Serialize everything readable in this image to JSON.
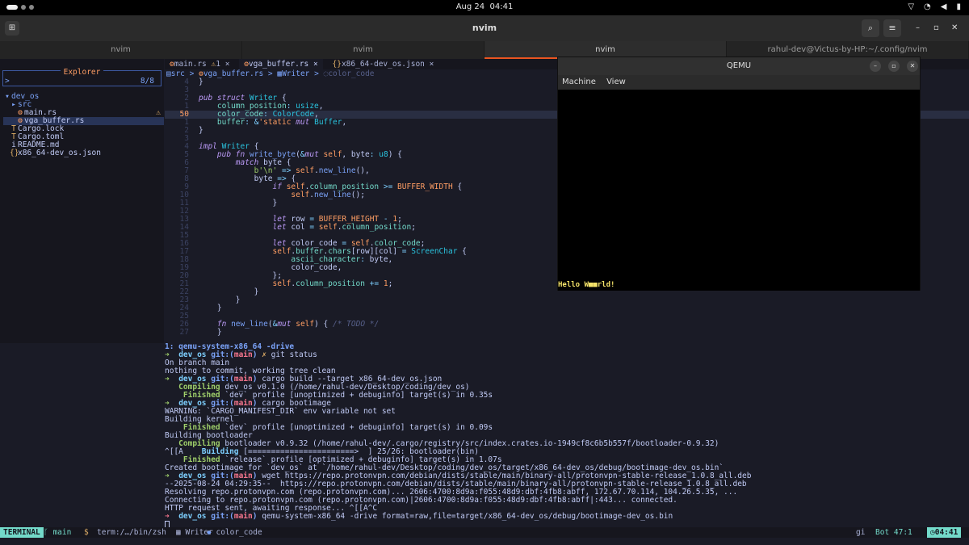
{
  "topbar": {
    "date": "Aug 24",
    "time": "04:41"
  },
  "window": {
    "title": "nvim"
  },
  "tabs": [
    {
      "label": "nvim",
      "active": false
    },
    {
      "label": "nvim",
      "active": false
    },
    {
      "label": "nvim",
      "active": true
    },
    {
      "label": "rahul-dev@Victus-by-HP:~/.config/nvim",
      "active": false
    }
  ],
  "explorer": {
    "title": "Explorer",
    "prompt": ">",
    "count": "8/8",
    "tree": [
      {
        "icon": "▾",
        "label": "dev_os",
        "color": "#7aa2f7",
        "indent": 0
      },
      {
        "icon": "▸",
        "label": "src",
        "color": "#7aa2f7",
        "indent": 1
      },
      {
        "icon": "⚙",
        "label": "main.rs",
        "color": "#c0caf5",
        "indent": 2,
        "warn": "⚠"
      },
      {
        "icon": "⚙",
        "label": "vga_buffer.rs",
        "color": "#c0caf5",
        "indent": 2,
        "selected": true
      },
      {
        "icon": "T",
        "label": "Cargo.lock",
        "color": "#c0caf5",
        "indent": 1
      },
      {
        "icon": "T",
        "label": "Cargo.toml",
        "color": "#c0caf5",
        "indent": 1
      },
      {
        "icon": "i",
        "label": "README.md",
        "color": "#c0caf5",
        "indent": 1
      },
      {
        "icon": "{}",
        "label": "x86_64-dev_os.json",
        "color": "#c0caf5",
        "indent": 1
      }
    ]
  },
  "buffers": [
    {
      "label": "main.rs",
      "extra": "1",
      "active": false
    },
    {
      "label": "vga_buffer.rs",
      "extra": "",
      "active": true
    },
    {
      "label": "x86_64-dev_os.json",
      "extra": "",
      "active": false
    }
  ],
  "breadcrumbs": {
    "a": "src",
    "b": "vga_buffer.rs",
    "c": "Writer",
    "d": "color_code"
  },
  "code_lines": [
    {
      "num": "4",
      "html": "<span class='v'>}</span>"
    },
    {
      "num": "3",
      "html": ""
    },
    {
      "num": "2",
      "html": "<span class='k'>pub struct</span> <span class='t'>Writer</span> <span class='v'>{</span>"
    },
    {
      "num": "1",
      "html": "    <span class='fld'>column_position</span><span class='p'>:</span> <span class='t'>usize</span><span class='v'>,</span>"
    },
    {
      "num": "50",
      "cur": true,
      "html": "    <span class='fld'>color_code</span><span class='p'>:</span> <span class='t'>ColorCode</span><span class='v'>,</span>"
    },
    {
      "num": "1",
      "html": "    <span class='fld'>buffer</span><span class='p'>:</span> <span class='p'>&amp;</span><span class='n'>'static</span> <span class='k'>mut</span> <span class='t'>Buffer</span><span class='v'>,</span>"
    },
    {
      "num": "2",
      "html": "<span class='v'>}</span>"
    },
    {
      "num": "3",
      "html": ""
    },
    {
      "num": "4",
      "html": "<span class='k'>impl</span> <span class='t'>Writer</span> <span class='v'>{</span>"
    },
    {
      "num": "5",
      "html": "    <span class='k'>pub fn</span> <span class='f'>write_byte</span><span class='v'>(</span><span class='p'>&amp;</span><span class='k'>mut</span> <span class='n'>self</span><span class='v'>,</span> <span class='v'>byte</span><span class='p'>:</span> <span class='t'>u8</span><span class='v'>) {</span>"
    },
    {
      "num": "6",
      "html": "        <span class='k'>match</span> <span class='v'>byte {</span>"
    },
    {
      "num": "7",
      "html": "            <span class='s'>b'\\n'</span> <span class='p'>=&gt;</span> <span class='n'>self</span><span class='v'>.</span><span class='f'>new_line</span><span class='v'>(),</span>"
    },
    {
      "num": "8",
      "html": "            <span class='v'>byte</span> <span class='p'>=&gt;</span> <span class='v'>{</span>"
    },
    {
      "num": "9",
      "html": "                <span class='k'>if</span> <span class='n'>self</span><span class='v'>.</span><span class='fld'>column_position</span> <span class='p'>&gt;=</span> <span class='cst'>BUFFER_WIDTH</span> <span class='v'>{</span>"
    },
    {
      "num": "10",
      "html": "                    <span class='n'>self</span><span class='v'>.</span><span class='f'>new_line</span><span class='v'>();</span>"
    },
    {
      "num": "11",
      "html": "                <span class='v'>}</span>"
    },
    {
      "num": "12",
      "html": ""
    },
    {
      "num": "13",
      "html": "                <span class='k'>let</span> <span class='v'>row</span> <span class='p'>=</span> <span class='cst'>BUFFER_HEIGHT</span> <span class='p'>-</span> <span class='n'>1</span><span class='v'>;</span>"
    },
    {
      "num": "14",
      "html": "                <span class='k'>let</span> <span class='v'>col</span> <span class='p'>=</span> <span class='n'>self</span><span class='v'>.</span><span class='fld'>column_position</span><span class='v'>;</span>"
    },
    {
      "num": "15",
      "html": ""
    },
    {
      "num": "16",
      "html": "                <span class='k'>let</span> <span class='v'>color_code</span> <span class='p'>=</span> <span class='n'>self</span><span class='v'>.</span><span class='fld'>color_code</span><span class='v'>;</span>"
    },
    {
      "num": "17",
      "html": "                <span class='n'>self</span><span class='v'>.</span><span class='fld'>buffer</span><span class='v'>.</span><span class='fld'>chars</span><span class='v'>[row][col]</span> <span class='p'>=</span> <span class='t'>ScreenChar</span> <span class='v'>{</span>"
    },
    {
      "num": "18",
      "html": "                    <span class='fld'>ascii_character</span><span class='p'>:</span> <span class='v'>byte,</span>"
    },
    {
      "num": "19",
      "html": "                    <span class='v'>color_code,</span>"
    },
    {
      "num": "20",
      "html": "                <span class='v'>};</span>"
    },
    {
      "num": "21",
      "html": "                <span class='n'>self</span><span class='v'>.</span><span class='fld'>column_position</span> <span class='p'>+=</span> <span class='n'>1</span><span class='v'>;</span>"
    },
    {
      "num": "22",
      "html": "            <span class='v'>}</span>"
    },
    {
      "num": "23",
      "html": "        <span class='v'>}</span>"
    },
    {
      "num": "24",
      "html": "    <span class='v'>}</span>"
    },
    {
      "num": "25",
      "html": ""
    },
    {
      "num": "26",
      "html": "    <span class='k'>fn</span> <span class='f'>new_line</span><span class='v'>(</span><span class='p'>&amp;</span><span class='k'>mut</span> <span class='n'>self</span><span class='v'>) {</span> <span class='c'>/* TODO */</span>"
    },
    {
      "num": "27",
      "html": "    <span class='v'>}</span>"
    }
  ],
  "qemu": {
    "title": "QEMU",
    "menu": [
      "Machine",
      "View"
    ],
    "screen_text": "Hello W■■rld!"
  },
  "terminal_lines": [
    "<span class='bl'>1: qemu-system-x86_64 -drive</span>",
    "<span class='g'>➜</span>  <span class='cy'>dev_os</span> <span class='bl'>git:(</span><span class='rd'>main</span><span class='bl'>)</span> <span class='yl'>✗</span> git status",
    "On branch main",
    "nothing to commit, working tree clean",
    "<span class='g'>➜</span>  <span class='cy'>dev_os</span> <span class='bl'>git:(</span><span class='rd'>main</span><span class='bl'>)</span> cargo build --target x86_64-dev_os.json",
    "   <span class='g'>Compiling</span> dev_os v0.1.0 (/home/rahul-dev/Desktop/coding/dev_os)",
    "    <span class='g'>Finished</span> `dev` profile [unoptimized + debuginfo] target(s) in 0.35s",
    "<span class='g'>➜</span>  <span class='cy'>dev_os</span> <span class='bl'>git:(</span><span class='rd'>main</span><span class='bl'>)</span> cargo bootimage",
    "WARNING: `CARGO_MANIFEST_DIR` env variable not set",
    "Building kernel",
    "    <span class='g'>Finished</span> `dev` profile [unoptimized + debuginfo] target(s) in 0.09s",
    "Building bootloader",
    "   <span class='g'>Compiling</span> bootloader v0.9.32 (/home/rahul-dev/.cargo/registry/src/index.crates.io-1949cf8c6b5b557f/bootloader-0.9.32)",
    "^[[A    <span class='cy'>Building</span> [=======================&gt;  ] 25/26: bootloader(bin)",
    "    <span class='g'>Finished</span> `release` profile [optimized + debuginfo] target(s) in 1.07s",
    "Created bootimage for `dev_os` at `/home/rahul-dev/Desktop/coding/dev_os/target/x86_64-dev_os/debug/bootimage-dev_os.bin`",
    "<span class='g'>➜</span>  <span class='cy'>dev_os</span> <span class='bl'>git:(</span><span class='rd'>main</span><span class='bl'>)</span> wget https://repo.protonvpn.com/debian/dists/stable/main/binary-all/protonvpn-stable-release_1.0.8_all.deb",
    "--2025-08-24 04:29:35--  https://repo.protonvpn.com/debian/dists/stable/main/binary-all/protonvpn-stable-release_1.0.8_all.deb",
    "Resolving repo.protonvpn.com (repo.protonvpn.com)... 2606:4700:8d9a:f055:48d9:dbf:4fb8:abff, 172.67.70.114, 104.26.5.35, ...",
    "Connecting to repo.protonvpn.com (repo.protonvpn.com)|2606:4700:8d9a:f055:48d9:dbf:4fb8:abff|:443... connected.",
    "HTTP request sent, awaiting response... ^[[A^C",
    "<span class='rd'>➜</span>  <span class='cy'>dev_os</span> <span class='bl'>git:(</span><span class='rd'>main</span><span class='bl'>)</span> qemu-system-x86_64 -drive format=raw,file=target/x86_64-dev_os/debug/bootimage-dev_os.bin"
  ],
  "statusline": {
    "mode": "TERMINAL",
    "branch": "main",
    "dollar": "$",
    "path": "term:/…/bin/zsh",
    "symbol1": "Writer",
    "symbol2": "color_code",
    "filetype": "gi",
    "position": "Bot  47:1",
    "clock": "04:41"
  },
  "colors": {
    "accent": "#e95420",
    "cyan": "#73daca",
    "blue": "#7aa2f7",
    "bg": "#1a1b26"
  }
}
